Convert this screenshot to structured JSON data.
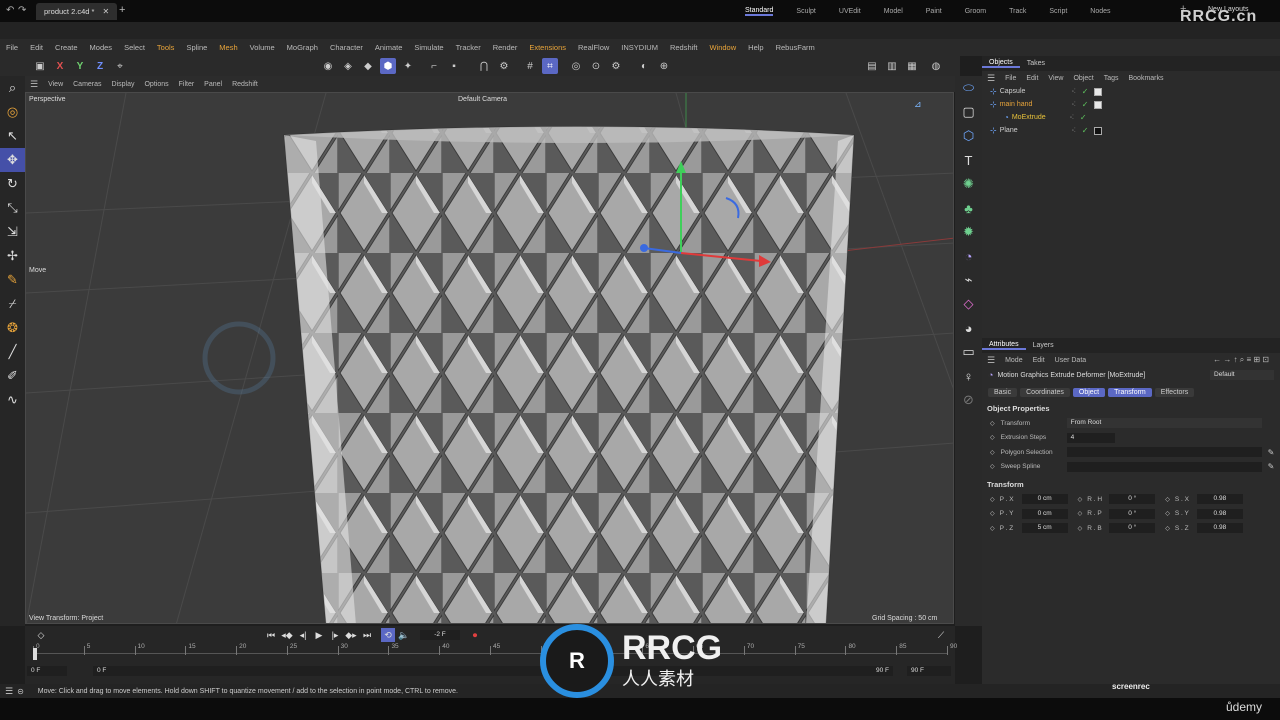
{
  "titlebar": {
    "file_tab": "product 2.c4d *",
    "watermark": "RRCG.cn"
  },
  "layouts": {
    "items": [
      "Standard",
      "Sculpt",
      "UVEdit",
      "Model",
      "Paint",
      "Groom",
      "Track",
      "Script",
      "Nodes"
    ],
    "active": "Standard",
    "new_layouts": "New Layouts"
  },
  "menubar": {
    "items": [
      "File",
      "Edit",
      "Create",
      "Modes",
      "Select",
      "Tools",
      "Spline",
      "Mesh",
      "Volume",
      "MoGraph",
      "Character",
      "Animate",
      "Simulate",
      "Tracker",
      "Render",
      "Extensions",
      "RealFlow",
      "INSYDIUM",
      "Redshift",
      "Window",
      "Help",
      "RebusFarm"
    ],
    "highlighted": [
      "Tools",
      "Mesh",
      "Extensions",
      "Window"
    ]
  },
  "toolbar": {
    "axes": [
      "X",
      "Y",
      "Z"
    ]
  },
  "viewport": {
    "menu": [
      "View",
      "Cameras",
      "Display",
      "Options",
      "Filter",
      "Panel",
      "Redshift"
    ],
    "name": "Perspective",
    "camera": "Default Camera",
    "move_label": "Move",
    "view_transform": "View Transform: Project",
    "grid_spacing": "Grid Spacing : 50 cm"
  },
  "objects": {
    "tabs": [
      "Objects",
      "Takes"
    ],
    "menu": [
      "File",
      "Edit",
      "View",
      "Object",
      "Tags",
      "Bookmarks"
    ],
    "items": [
      {
        "name": "Capsule",
        "color": "#cfcfcf",
        "indent": 0
      },
      {
        "name": "main hand",
        "color": "#e8a43a",
        "indent": 0
      },
      {
        "name": "MoExtrude",
        "color": "#e8c23a",
        "indent": 1
      },
      {
        "name": "Plane",
        "color": "#cfcfcf",
        "indent": 0
      }
    ]
  },
  "attributes": {
    "tabs": [
      "Attributes",
      "Layers"
    ],
    "menu": [
      "Mode",
      "Edit",
      "User Data"
    ],
    "title": "Motion Graphics Extrude Deformer [MoExtrude]",
    "preset": "Default",
    "buttons": [
      "Basic",
      "Coordinates",
      "Object",
      "Transform",
      "Effectors"
    ],
    "active_buttons": [
      "Object",
      "Transform"
    ],
    "object_properties_heading": "Object Properties",
    "props": [
      {
        "label": "Transform",
        "value": "From Root"
      },
      {
        "label": "Extrusion Steps",
        "value": "4"
      },
      {
        "label": "Polygon Selection",
        "value": ""
      },
      {
        "label": "Sweep Spline",
        "value": ""
      }
    ],
    "transform_heading": "Transform",
    "transform": [
      [
        {
          "l": "P . X",
          "v": "0 cm"
        },
        {
          "l": "R . H",
          "v": "0 °"
        },
        {
          "l": "S . X",
          "v": "0.98"
        }
      ],
      [
        {
          "l": "P . Y",
          "v": "0 cm"
        },
        {
          "l": "R . P",
          "v": "0 °"
        },
        {
          "l": "S . Y",
          "v": "0.98"
        }
      ],
      [
        {
          "l": "P . Z",
          "v": "5 cm"
        },
        {
          "l": "R . B",
          "v": "0 °"
        },
        {
          "l": "S . Z",
          "v": "0.98"
        }
      ]
    ]
  },
  "timeline": {
    "current_frame": "-2 F",
    "ticks": [
      "0",
      "5",
      "10",
      "15",
      "20",
      "25",
      "30",
      "35",
      "40",
      "45",
      "50",
      "55",
      "60",
      "65",
      "70",
      "75",
      "80",
      "85",
      "90"
    ],
    "start": "0 F",
    "start2": "0 F",
    "end": "90 F",
    "end2": "90 F"
  },
  "status": {
    "text": "Move: Click and drag to move elements. Hold down SHIFT to quantize movement / add to the selection in point mode, CTRL to remove."
  },
  "watermarks": {
    "center": "RRCG",
    "center_sub": "人人素材",
    "screenrec": "screenrec",
    "udemy": "ůdemy"
  }
}
